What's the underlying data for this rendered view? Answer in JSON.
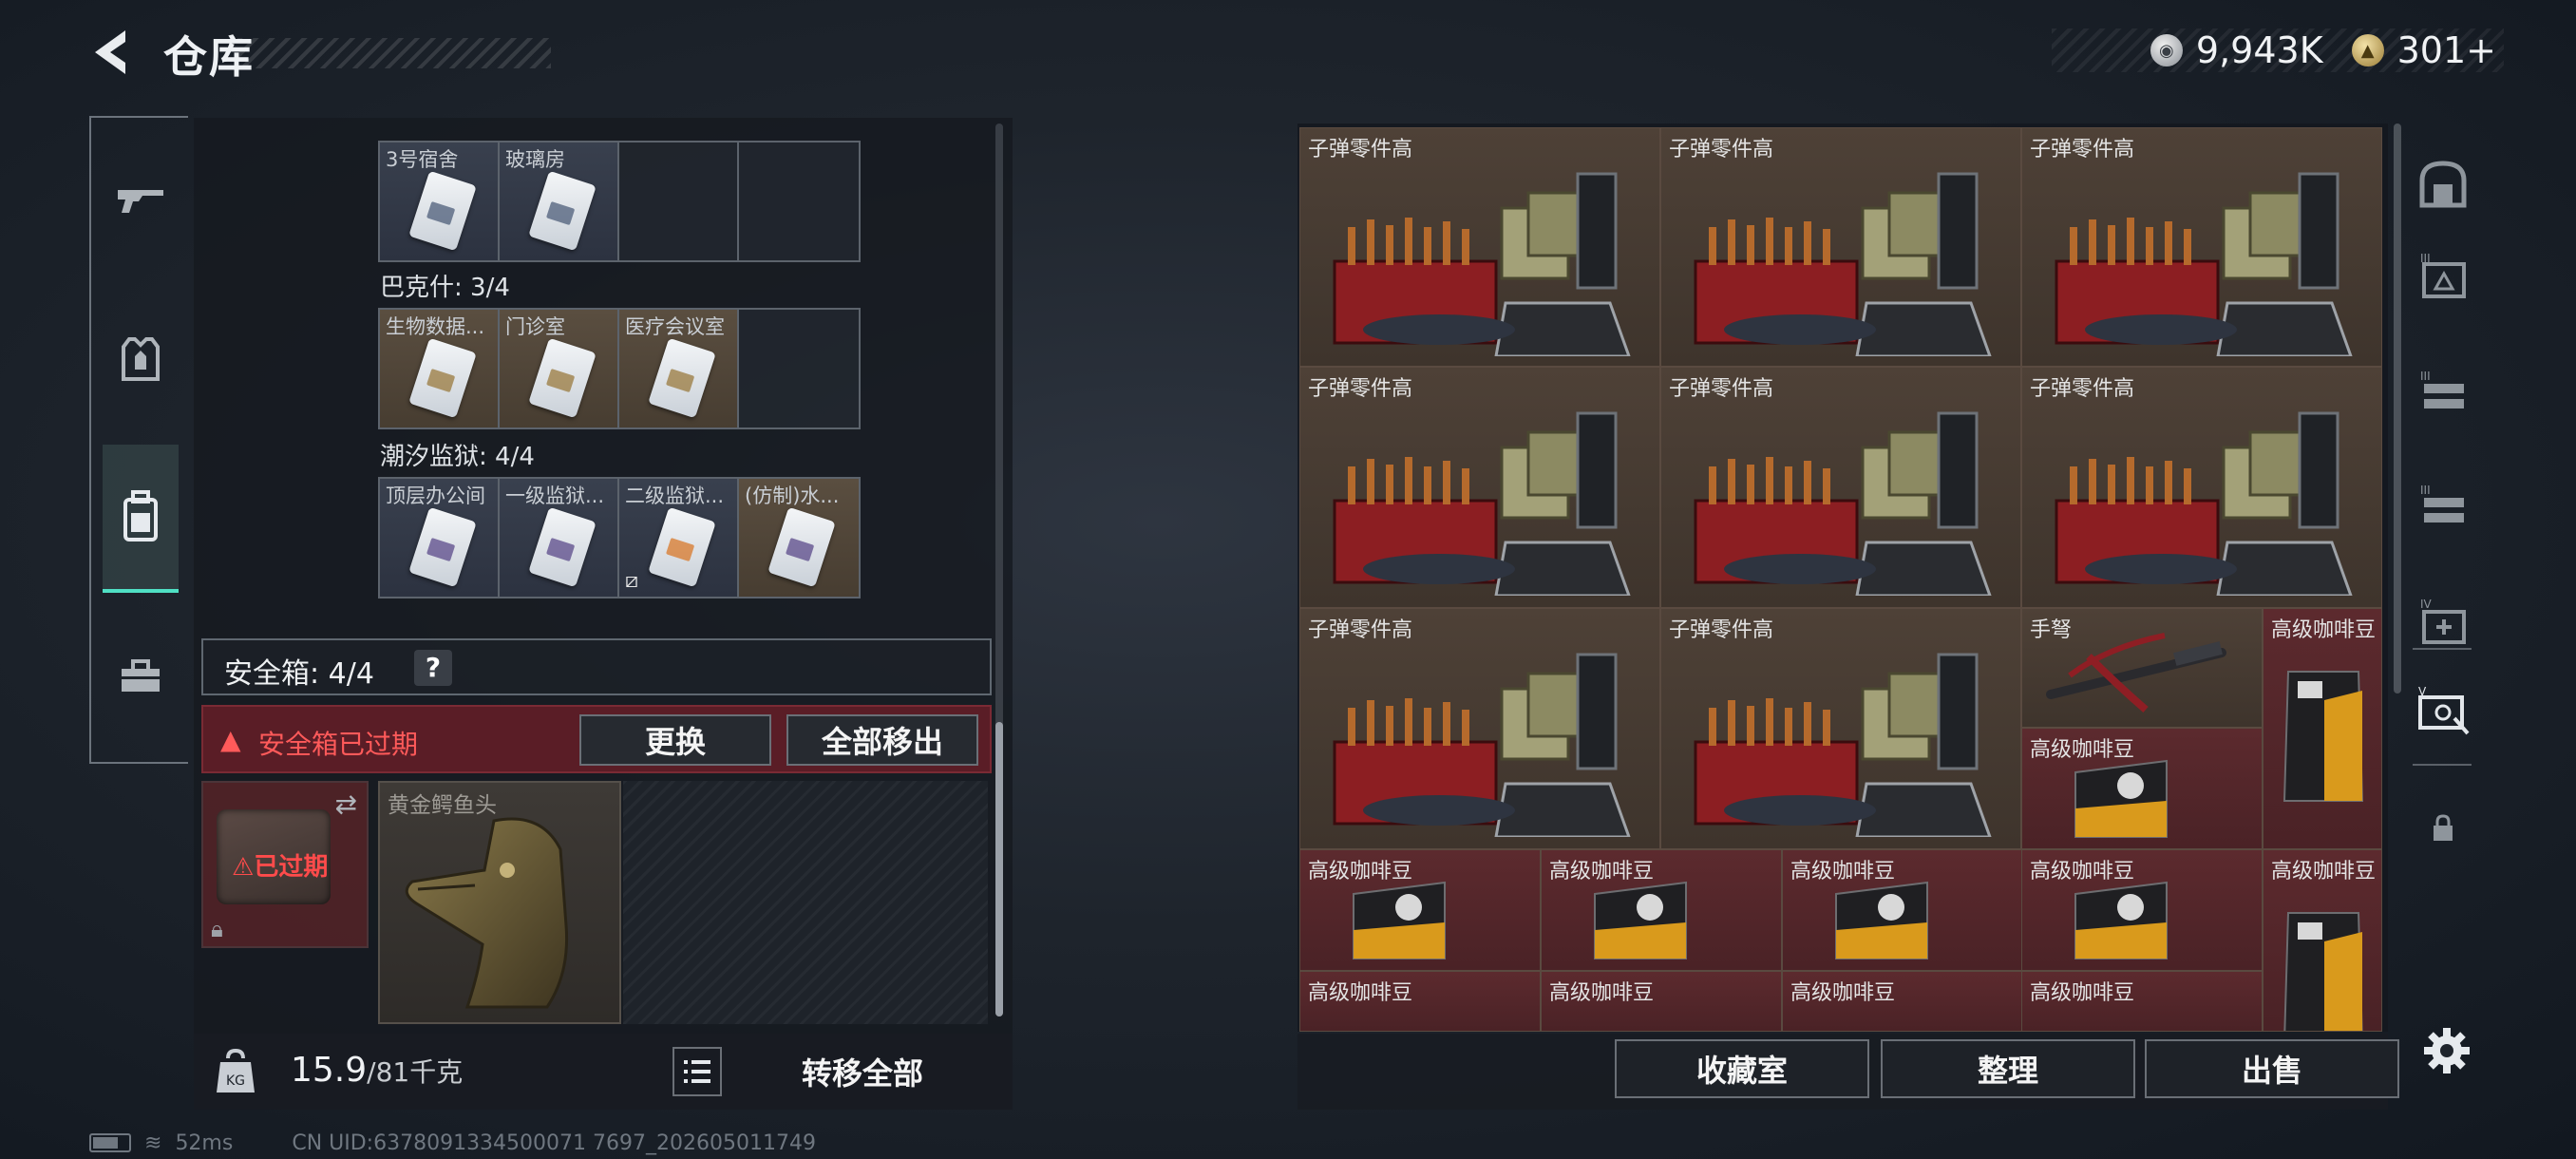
{
  "header": {
    "title": "仓库"
  },
  "currency": {
    "silver": "9,943K",
    "gold": "301+"
  },
  "left_tabs": [
    {
      "icon": "rifle-icon"
    },
    {
      "icon": "armor-vest-icon"
    },
    {
      "icon": "backpack-icon",
      "active": true
    },
    {
      "icon": "toolbox-icon"
    }
  ],
  "keycards": {
    "row1": {
      "slots": [
        {
          "label": "3号宿舍"
        },
        {
          "label": "玻璃房"
        },
        {
          "label": ""
        },
        {
          "label": ""
        }
      ]
    },
    "bakesh": {
      "title": "巴克什: 3/4",
      "slots": [
        {
          "label": "生物数据..."
        },
        {
          "label": "门诊室"
        },
        {
          "label": "医疗会议室"
        },
        {
          "label": ""
        }
      ]
    },
    "prison": {
      "title": "潮汐监狱: 4/4",
      "slots": [
        {
          "label": "顶层办公间"
        },
        {
          "label": "一级监狱..."
        },
        {
          "label": "二级监狱..."
        },
        {
          "label": "(仿制)水..."
        }
      ]
    }
  },
  "safebox": {
    "label": "安全箱: 4/4",
    "help": "?",
    "expired_notice": "安全箱已过期",
    "replace_btn": "更换",
    "move_all_btn": "全部移出",
    "slot_status": "已过期",
    "item_label": "黄金鳄鱼头"
  },
  "weight": {
    "current": "15.9",
    "max": "/81千克"
  },
  "left_bottom": {
    "transfer_all": "转移全部"
  },
  "storage_grid": {
    "big_items": [
      {
        "label": "子弹零件高"
      },
      {
        "label": "子弹零件高"
      },
      {
        "label": "子弹零件高"
      },
      {
        "label": "子弹零件高"
      },
      {
        "label": "子弹零件高"
      },
      {
        "label": "子弹零件高"
      },
      {
        "label": "子弹零件高"
      },
      {
        "label": "子弹零件高"
      }
    ],
    "crossbow": {
      "label": "手弩"
    },
    "coffee_label": "高级咖啡豆"
  },
  "right_rail": [
    {
      "icon": "vault-icon"
    },
    {
      "icon": "ammo-crate-iii-icon"
    },
    {
      "icon": "shelf-iii-icon"
    },
    {
      "icon": "shelf-iii-icon"
    },
    {
      "icon": "medkit-iv-icon"
    },
    {
      "icon": "crate-filter-icon"
    },
    {
      "icon": "lock-icon"
    }
  ],
  "right_bottom": {
    "collection_btn": "收藏室",
    "sort_btn": "整理",
    "sell_btn": "出售"
  },
  "footer": {
    "ping": "52ms",
    "uid": "CN UID:6378091334500071 7697_202605011749"
  }
}
